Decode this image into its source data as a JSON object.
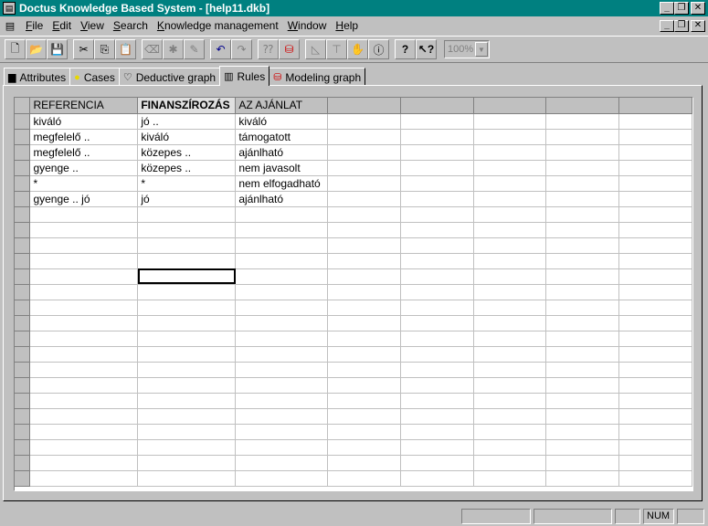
{
  "window": {
    "title": "Doctus Knowledge Based System - [help11.dkb]"
  },
  "menu": [
    {
      "pre": "",
      "ul": "F",
      "post": "ile"
    },
    {
      "pre": "",
      "ul": "E",
      "post": "dit"
    },
    {
      "pre": "",
      "ul": "V",
      "post": "iew"
    },
    {
      "pre": "",
      "ul": "S",
      "post": "earch"
    },
    {
      "pre": "",
      "ul": "K",
      "post": "nowledge management"
    },
    {
      "pre": "",
      "ul": "W",
      "post": "indow"
    },
    {
      "pre": "",
      "ul": "H",
      "post": "elp"
    }
  ],
  "toolbar": {
    "zoom": "100%"
  },
  "tabs": [
    {
      "label": "Attributes",
      "icon": "briefcase-icon"
    },
    {
      "label": "Cases",
      "icon": "bulb-icon"
    },
    {
      "label": "Deductive graph",
      "icon": "tree-icon"
    },
    {
      "label": "Rules",
      "icon": "rules-icon",
      "active": true
    },
    {
      "label": "Modeling graph",
      "icon": "stack-icon"
    }
  ],
  "grid": {
    "headers": [
      "REFERENCIA",
      "FINANSZÍROZÁS",
      "AZ AJÁNLAT",
      "",
      "",
      "",
      "",
      ""
    ],
    "rows": [
      [
        "kiváló",
        "jó ..",
        "kiváló"
      ],
      [
        "megfelelő ..",
        "kiváló",
        "támogatott"
      ],
      [
        "megfelelő ..",
        "közepes ..",
        "ajánlható"
      ],
      [
        "gyenge ..",
        "közepes ..",
        "nem javasolt"
      ],
      [
        "*",
        "*",
        "nem elfogadható"
      ],
      [
        "gyenge .. jó",
        "jó",
        "ajánlható"
      ]
    ]
  },
  "status": {
    "num": "NUM"
  }
}
